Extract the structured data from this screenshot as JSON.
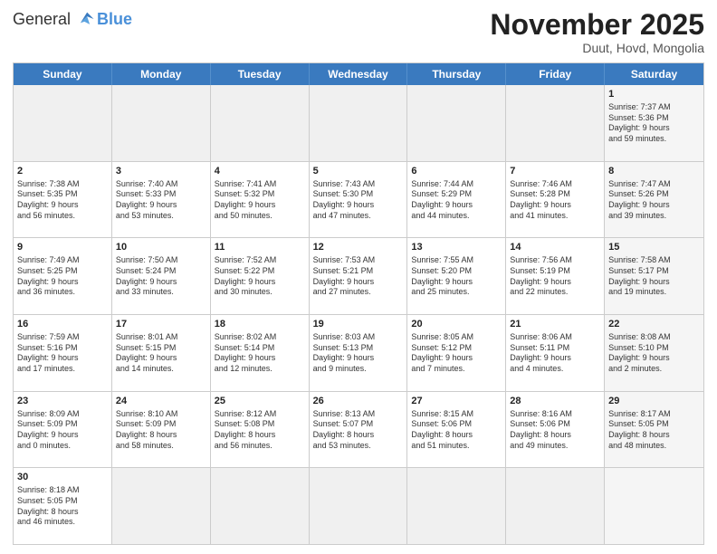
{
  "logo": {
    "text_general": "General",
    "text_blue": "Blue"
  },
  "title": {
    "month_year": "November 2025",
    "location": "Duut, Hovd, Mongolia"
  },
  "header_days": [
    "Sunday",
    "Monday",
    "Tuesday",
    "Wednesday",
    "Thursday",
    "Friday",
    "Saturday"
  ],
  "weeks": [
    [
      {
        "day": "",
        "info": "",
        "empty": true
      },
      {
        "day": "",
        "info": "",
        "empty": true
      },
      {
        "day": "",
        "info": "",
        "empty": true
      },
      {
        "day": "",
        "info": "",
        "empty": true
      },
      {
        "day": "",
        "info": "",
        "empty": true
      },
      {
        "day": "",
        "info": "",
        "empty": true
      },
      {
        "day": "1",
        "info": "Sunrise: 7:37 AM\nSunset: 5:36 PM\nDaylight: 9 hours\nand 59 minutes.",
        "saturday": true
      }
    ],
    [
      {
        "day": "2",
        "info": "Sunrise: 7:38 AM\nSunset: 5:35 PM\nDaylight: 9 hours\nand 56 minutes."
      },
      {
        "day": "3",
        "info": "Sunrise: 7:40 AM\nSunset: 5:33 PM\nDaylight: 9 hours\nand 53 minutes."
      },
      {
        "day": "4",
        "info": "Sunrise: 7:41 AM\nSunset: 5:32 PM\nDaylight: 9 hours\nand 50 minutes."
      },
      {
        "day": "5",
        "info": "Sunrise: 7:43 AM\nSunset: 5:30 PM\nDaylight: 9 hours\nand 47 minutes."
      },
      {
        "day": "6",
        "info": "Sunrise: 7:44 AM\nSunset: 5:29 PM\nDaylight: 9 hours\nand 44 minutes."
      },
      {
        "day": "7",
        "info": "Sunrise: 7:46 AM\nSunset: 5:28 PM\nDaylight: 9 hours\nand 41 minutes."
      },
      {
        "day": "8",
        "info": "Sunrise: 7:47 AM\nSunset: 5:26 PM\nDaylight: 9 hours\nand 39 minutes.",
        "saturday": true
      }
    ],
    [
      {
        "day": "9",
        "info": "Sunrise: 7:49 AM\nSunset: 5:25 PM\nDaylight: 9 hours\nand 36 minutes."
      },
      {
        "day": "10",
        "info": "Sunrise: 7:50 AM\nSunset: 5:24 PM\nDaylight: 9 hours\nand 33 minutes."
      },
      {
        "day": "11",
        "info": "Sunrise: 7:52 AM\nSunset: 5:22 PM\nDaylight: 9 hours\nand 30 minutes."
      },
      {
        "day": "12",
        "info": "Sunrise: 7:53 AM\nSunset: 5:21 PM\nDaylight: 9 hours\nand 27 minutes."
      },
      {
        "day": "13",
        "info": "Sunrise: 7:55 AM\nSunset: 5:20 PM\nDaylight: 9 hours\nand 25 minutes."
      },
      {
        "day": "14",
        "info": "Sunrise: 7:56 AM\nSunset: 5:19 PM\nDaylight: 9 hours\nand 22 minutes."
      },
      {
        "day": "15",
        "info": "Sunrise: 7:58 AM\nSunset: 5:17 PM\nDaylight: 9 hours\nand 19 minutes.",
        "saturday": true
      }
    ],
    [
      {
        "day": "16",
        "info": "Sunrise: 7:59 AM\nSunset: 5:16 PM\nDaylight: 9 hours\nand 17 minutes."
      },
      {
        "day": "17",
        "info": "Sunrise: 8:01 AM\nSunset: 5:15 PM\nDaylight: 9 hours\nand 14 minutes."
      },
      {
        "day": "18",
        "info": "Sunrise: 8:02 AM\nSunset: 5:14 PM\nDaylight: 9 hours\nand 12 minutes."
      },
      {
        "day": "19",
        "info": "Sunrise: 8:03 AM\nSunset: 5:13 PM\nDaylight: 9 hours\nand 9 minutes."
      },
      {
        "day": "20",
        "info": "Sunrise: 8:05 AM\nSunset: 5:12 PM\nDaylight: 9 hours\nand 7 minutes."
      },
      {
        "day": "21",
        "info": "Sunrise: 8:06 AM\nSunset: 5:11 PM\nDaylight: 9 hours\nand 4 minutes."
      },
      {
        "day": "22",
        "info": "Sunrise: 8:08 AM\nSunset: 5:10 PM\nDaylight: 9 hours\nand 2 minutes.",
        "saturday": true
      }
    ],
    [
      {
        "day": "23",
        "info": "Sunrise: 8:09 AM\nSunset: 5:09 PM\nDaylight: 9 hours\nand 0 minutes."
      },
      {
        "day": "24",
        "info": "Sunrise: 8:10 AM\nSunset: 5:09 PM\nDaylight: 8 hours\nand 58 minutes."
      },
      {
        "day": "25",
        "info": "Sunrise: 8:12 AM\nSunset: 5:08 PM\nDaylight: 8 hours\nand 56 minutes."
      },
      {
        "day": "26",
        "info": "Sunrise: 8:13 AM\nSunset: 5:07 PM\nDaylight: 8 hours\nand 53 minutes."
      },
      {
        "day": "27",
        "info": "Sunrise: 8:15 AM\nSunset: 5:06 PM\nDaylight: 8 hours\nand 51 minutes."
      },
      {
        "day": "28",
        "info": "Sunrise: 8:16 AM\nSunset: 5:06 PM\nDaylight: 8 hours\nand 49 minutes."
      },
      {
        "day": "29",
        "info": "Sunrise: 8:17 AM\nSunset: 5:05 PM\nDaylight: 8 hours\nand 48 minutes.",
        "saturday": true
      }
    ],
    [
      {
        "day": "30",
        "info": "Sunrise: 8:18 AM\nSunset: 5:05 PM\nDaylight: 8 hours\nand 46 minutes."
      },
      {
        "day": "",
        "info": "",
        "empty": true
      },
      {
        "day": "",
        "info": "",
        "empty": true
      },
      {
        "day": "",
        "info": "",
        "empty": true
      },
      {
        "day": "",
        "info": "",
        "empty": true
      },
      {
        "day": "",
        "info": "",
        "empty": true
      },
      {
        "day": "",
        "info": "",
        "empty": true,
        "saturday": true
      }
    ]
  ]
}
